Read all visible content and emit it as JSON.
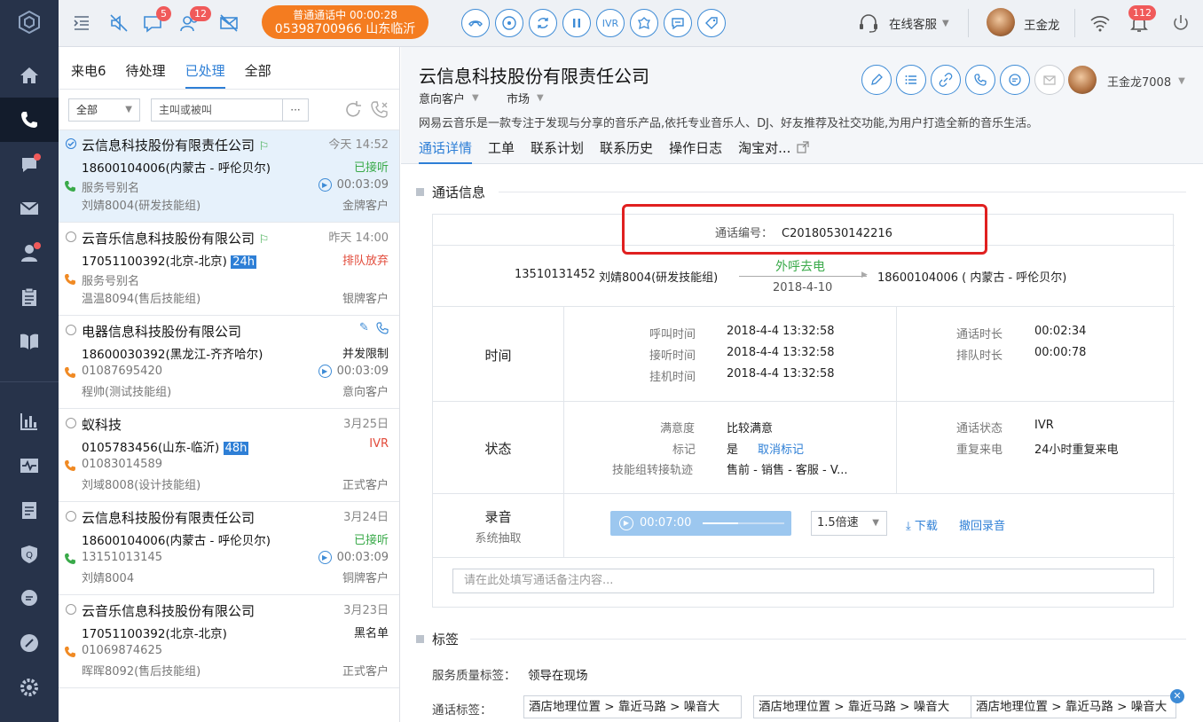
{
  "topbar": {
    "msg_badge": "5",
    "contacts_badge": "12",
    "call_status": "普通通话中  00:00:28",
    "call_number": "05398700966 山东临沂",
    "ivr_label": "IVR",
    "service_status": "在线客服",
    "user_name": "王金龙",
    "notif_badge": "112"
  },
  "list": {
    "tabs": [
      "来电6",
      "待处理",
      "已处理",
      "全部"
    ],
    "filter_select": "全部",
    "search_placeholder": "主叫或被叫",
    "more": "···",
    "items": [
      {
        "name": "云信息科技股份有限责任公司",
        "time": "今天 14:52",
        "phone": "18600104006(内蒙古 - 呼伦贝尔)",
        "status": "已接听",
        "alias": "服务号别名",
        "duration": "00:03:09",
        "agent": "刘婧8004(研发技能组)",
        "level": "金牌客户"
      },
      {
        "name": "云音乐信息科技股份有限公司",
        "time": "昨天 14:00",
        "phone": "17051100392(北京-北京)",
        "tag": "24h",
        "status": "排队放弃",
        "alias": "服务号别名",
        "agent": "温温8094(售后技能组)",
        "level": "银牌客户"
      },
      {
        "name": "电器信息科技股份有限公司",
        "phone": "18600030392(黑龙江-齐齐哈尔)",
        "status": "并发限制",
        "alias": "01087695420",
        "duration": "00:03:09",
        "agent": "程帅(测试技能组)",
        "level": "意向客户"
      },
      {
        "name": "蚁科技",
        "time": "3月25日",
        "phone": "0105783456(山东-临沂)",
        "tag": "48h",
        "status": "IVR",
        "alias": "01083014589",
        "agent": "刘域8008(设计技能组)",
        "level": "正式客户"
      },
      {
        "name": "云信息科技股份有限责任公司",
        "time": "3月24日",
        "phone": "18600104006(内蒙古 - 呼伦贝尔)",
        "status": "已接听",
        "alias": "13151013145",
        "duration": "00:03:09",
        "agent": "刘婧8004",
        "level": "铜牌客户"
      },
      {
        "name": "云音乐信息科技股份有限公司",
        "time": "3月23日",
        "phone": "17051100392(北京-北京)",
        "status": "黑名单",
        "alias": "01069874625",
        "agent": "晖晖8092(售后技能组)",
        "level": "正式客户"
      }
    ]
  },
  "detail": {
    "company": "云信息科技股份有限责任公司",
    "customer_type": "意向客户",
    "market": "市场",
    "agent": "王金龙7008",
    "description": "网易云音乐是一款专注于发现与分享的音乐产品,依托专业音乐人、DJ、好友推荐及社交功能,为用户打造全新的音乐生活。",
    "tabs": [
      "通话详情",
      "工单",
      "联系计划",
      "联系历史",
      "操作日志",
      "淘宝对..."
    ],
    "call_section": "通话信息",
    "call_id_label": "通话编号：",
    "call_id": "C20180530142216",
    "from_number": "13510131452",
    "from_agent": "刘婧8004(研发技能组)",
    "direction": "外呼去电",
    "call_date": "2018-4-10",
    "to": "18600104006 ( 内蒙古 - 呼伦贝尔)",
    "time_head": "时间",
    "call_time_label": "呼叫时间",
    "call_time": "2018-4-4 13:32:58",
    "answer_time_label": "接听时间",
    "answer_time": "2018-4-4 13:32:58",
    "hangup_time_label": "挂机时间",
    "hangup_time": "2018-4-4 13:32:58",
    "duration_label": "通话时长",
    "duration": "00:02:34",
    "queue_label": "排队时长",
    "queue": "00:00:78",
    "status_head": "状态",
    "satisfaction_label": "满意度",
    "satisfaction": "比较满意",
    "mark_label": "标记",
    "mark": "是",
    "cancel_mark": "取消标记",
    "transfer_label": "技能组转接轨迹",
    "transfer": "售前 - 销售 - 客服 - V...",
    "call_status_label": "通话状态",
    "call_status": "IVR",
    "repeat_label": "重复来电",
    "repeat": "24小时重复来电",
    "record_head": "录音",
    "record_sub": "系统抽取",
    "player_time": "00:07:00",
    "speed": "1.5倍速",
    "download": "下载",
    "revoke": "撤回录音",
    "note_placeholder": "请在此处填写通话备注内容...",
    "tag_section": "标签",
    "quality_label": "服务质量标签：",
    "quality_value": "领导在现场",
    "call_tag_label": "通话标签：",
    "call_tags": [
      "酒店地理位置 > 靠近马路 > 噪音大",
      "酒店地理位置 > 靠近马路 > 噪音大",
      "酒店地理位置 > 靠近马路 > 噪音大"
    ]
  }
}
